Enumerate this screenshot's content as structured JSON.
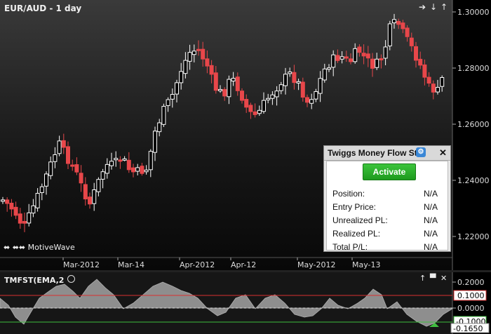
{
  "chart": {
    "symbol_label": "EUR/AUD - 1 day",
    "watermark": "MotiveWave",
    "watermark_icons": "⬌ ⬌⬌",
    "nav_icons": [
      "➔",
      "↓",
      "↑"
    ],
    "y_ticks": [
      "1.30000",
      "1.28000",
      "1.26000",
      "1.24000",
      "1.22000"
    ],
    "x_ticks": [
      "Mar-2012",
      "Mar-14",
      "Apr-2012",
      "Apr-12",
      "May-2012",
      "May-13"
    ]
  },
  "indicator": {
    "title": "TMFST(EMA,2 ",
    "y_ticks": [
      "0.2000",
      "0.0000"
    ],
    "upper_badge": "0.1000",
    "lower_badge_a": "-0.1000",
    "lower_badge_b": "-0.1650"
  },
  "strategy_panel": {
    "title": "Twiggs Money Flow Strategy",
    "activate_label": "Activate",
    "rows": [
      {
        "label": "Position:",
        "value": "N/A"
      },
      {
        "label": "Entry Price:",
        "value": "N/A"
      },
      {
        "label": "Unrealized PL:",
        "value": "N/A"
      },
      {
        "label": "Realized PL:",
        "value": "N/A"
      },
      {
        "label": "Total P/L:",
        "value": "N/A"
      }
    ]
  },
  "colors": {
    "bull": "#ffffff",
    "bear": "#e8474a",
    "upper_line": "#d93030",
    "lower_line": "#3fbf3f",
    "area": "#8e8e8e"
  }
}
